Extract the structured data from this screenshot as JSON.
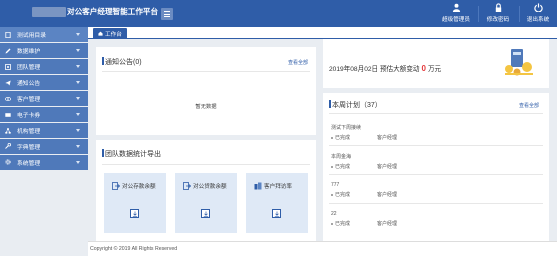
{
  "header": {
    "title": "对公客户经理智能工作平台",
    "tools": [
      {
        "label": "超级管理员",
        "icon": "user-icon"
      },
      {
        "label": "修改密码",
        "icon": "lock-icon"
      },
      {
        "label": "退出系统",
        "icon": "power-icon"
      }
    ],
    "colors": {
      "primary": "#2f5da8",
      "sidebar": "#4f79ba",
      "accent_red": "#e4393c"
    }
  },
  "sidebar": {
    "items": [
      {
        "label": "测试用目录",
        "icon": "document-icon"
      },
      {
        "label": "数据维护",
        "icon": "edit-icon"
      },
      {
        "label": "团队管理",
        "icon": "team-icon"
      },
      {
        "label": "通知公告",
        "icon": "send-icon"
      },
      {
        "label": "客户管理",
        "icon": "eye-icon"
      },
      {
        "label": "电子卡券",
        "icon": "card-icon"
      },
      {
        "label": "机构管理",
        "icon": "org-icon"
      },
      {
        "label": "字典管理",
        "icon": "wrench-icon"
      },
      {
        "label": "系统管理",
        "icon": "gear-icon"
      }
    ]
  },
  "tabs": [
    {
      "label": "工作台",
      "icon": "home-icon"
    }
  ],
  "notice": {
    "title": "通知公告(0)",
    "view_all": "查看全部",
    "empty": "暂无数据"
  },
  "export": {
    "title": "团队数据统计导出",
    "cards": [
      {
        "label": "对公存款余额",
        "icon": "export-icon"
      },
      {
        "label": "对公贷款余额",
        "icon": "export-icon"
      },
      {
        "label": "客户拜访率",
        "icon": "building-icon"
      }
    ]
  },
  "announcement": {
    "prefix": "2019年08月02日 预估大额变动",
    "amount": "0",
    "unit": "万元"
  },
  "plan": {
    "title": "本周计划（37）",
    "view_all": "查看全部",
    "items": [
      {
        "name": "测试下周接续",
        "status": "已完成",
        "owner": "客户经理"
      },
      {
        "name": "本周金海",
        "status": "已完成",
        "owner": "客户经理"
      },
      {
        "name": "777",
        "status": "已完成",
        "owner": "客户经理"
      },
      {
        "name": "22",
        "status": "已完成",
        "owner": "客户经理"
      }
    ]
  },
  "footer": {
    "text": "Copyright © 2019    All Rights Reserved"
  }
}
